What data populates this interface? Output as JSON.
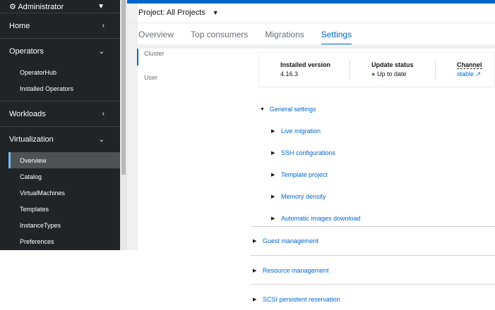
{
  "sidebar": {
    "perspective": "Administrator",
    "sections": [
      {
        "label": "Home"
      },
      {
        "label": "Operators",
        "items": [
          "OperatorHub",
          "Installed Operators"
        ]
      },
      {
        "label": "Workloads"
      },
      {
        "label": "Virtualization",
        "items": [
          "Overview",
          "Catalog",
          "VirtualMachines",
          "Templates",
          "InstanceTypes",
          "Preferences"
        ]
      }
    ]
  },
  "header": {
    "project": "Project: All Projects"
  },
  "tabs": [
    "Overview",
    "Top consumers",
    "Migrations",
    "Settings"
  ],
  "active_tab": "Settings",
  "vtabs": [
    "Cluster",
    "User"
  ],
  "card": {
    "installed_label": "Installed version",
    "installed_value": "4.16.3",
    "status_label": "Update status",
    "status_value": "Up to date",
    "channel_label": "Channel",
    "channel_value": "stable"
  },
  "general": {
    "label": "General settings",
    "items": [
      "Live migration",
      "SSH configurations",
      "Template project",
      "Memory density",
      "Automatic images download"
    ]
  },
  "sections": [
    "Guest management",
    "Resource management",
    "SCSI persistent reservation"
  ],
  "colors": {
    "accent": "#0066cc",
    "sidebar": "#212427",
    "success": "#3e8635"
  }
}
